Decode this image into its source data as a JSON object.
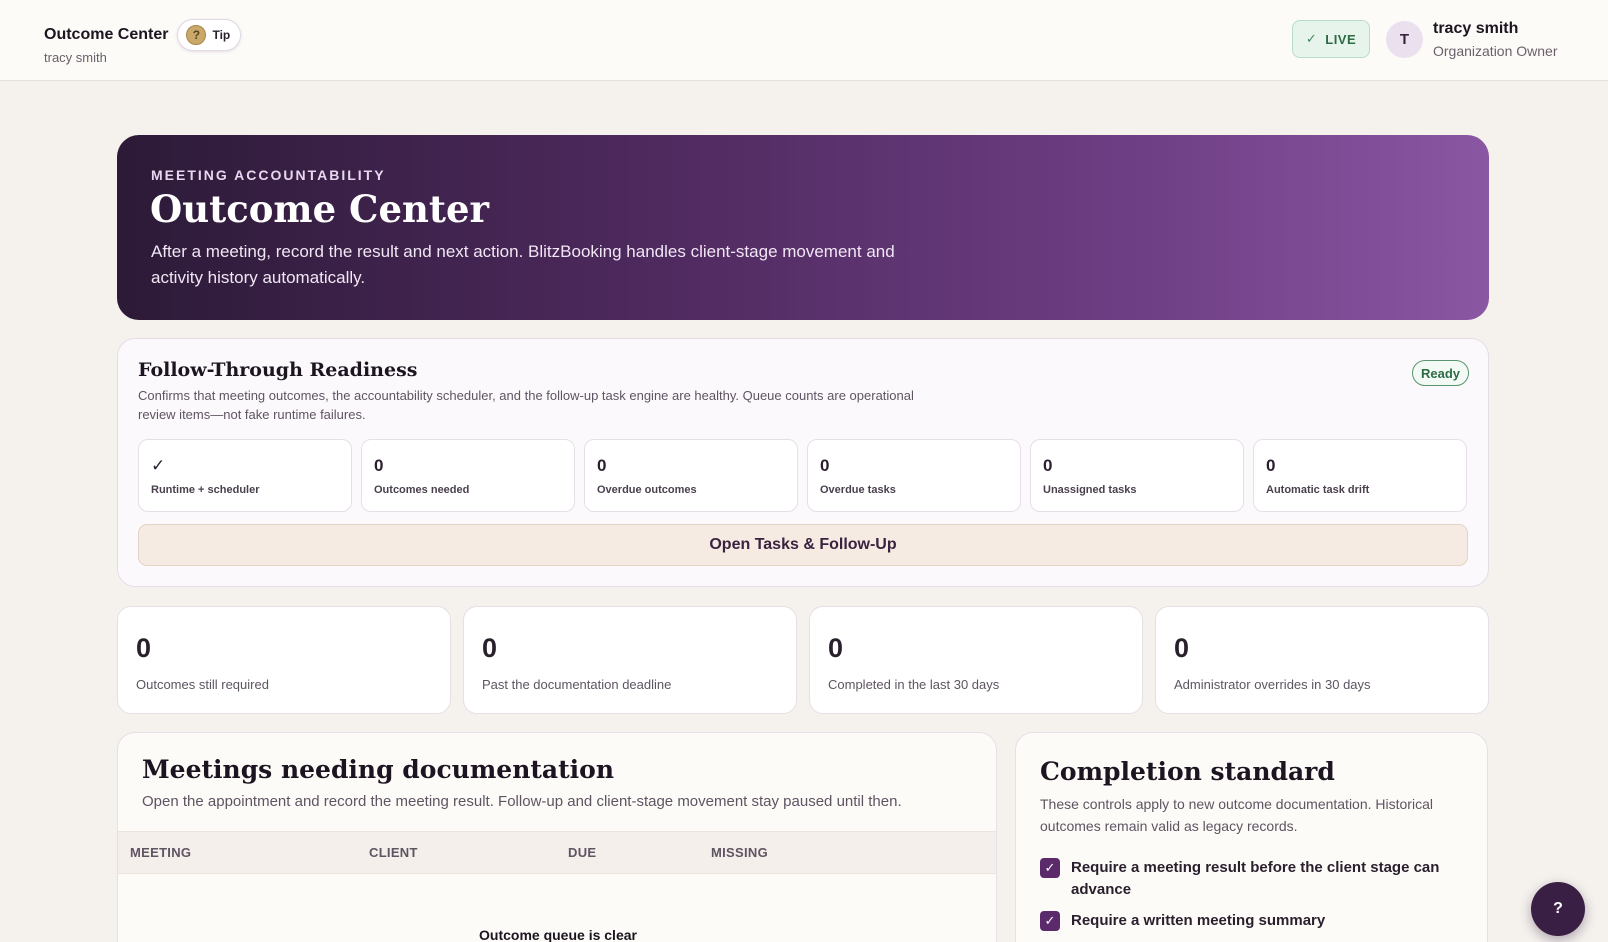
{
  "topbar": {
    "title": "Outcome Center",
    "tip_icon": "?",
    "tip_label": "Tip",
    "subtitle": "tracy smith",
    "live_check": "✓",
    "live_label": "LIVE",
    "avatar_initial": "T",
    "user_name": "tracy smith",
    "user_role": "Organization Owner"
  },
  "hero": {
    "eyebrow": "MEETING ACCOUNTABILITY",
    "title": "Outcome Center",
    "description": "After a meeting, record the result and next action. BlitzBooking handles client-stage movement and activity history automatically."
  },
  "readiness": {
    "title": "Follow-Through Readiness",
    "description": "Confirms that meeting outcomes, the accountability scheduler, and the follow-up task engine are healthy. Queue counts are operational review items—not fake runtime failures.",
    "badge": "Ready",
    "metrics": [
      {
        "value": "✓",
        "label": "Runtime + scheduler"
      },
      {
        "value": "0",
        "label": "Outcomes needed"
      },
      {
        "value": "0",
        "label": "Overdue outcomes"
      },
      {
        "value": "0",
        "label": "Overdue tasks"
      },
      {
        "value": "0",
        "label": "Unassigned tasks"
      },
      {
        "value": "0",
        "label": "Automatic task drift"
      }
    ],
    "open_button": "Open Tasks & Follow-Up"
  },
  "stats": [
    {
      "value": "0",
      "label": "Outcomes still required"
    },
    {
      "value": "0",
      "label": "Past the documentation deadline"
    },
    {
      "value": "0",
      "label": "Completed in the last 30 days"
    },
    {
      "value": "0",
      "label": "Administrator overrides in 30 days"
    }
  ],
  "meetings": {
    "title": "Meetings needing documentation",
    "description": "Open the appointment and record the meeting result. Follow-up and client-stage movement stay paused until then.",
    "columns": [
      "MEETING",
      "CLIENT",
      "DUE",
      "MISSING"
    ],
    "empty": "Outcome queue is clear"
  },
  "standard": {
    "title": "Completion standard",
    "description": "These controls apply to new outcome documentation. Historical outcomes remain valid as legacy records.",
    "options": [
      {
        "label": "Require a meeting result before the client stage can advance",
        "checked": true
      },
      {
        "label": "Require a written meeting summary",
        "checked": true
      }
    ]
  },
  "help_fab": "?"
}
